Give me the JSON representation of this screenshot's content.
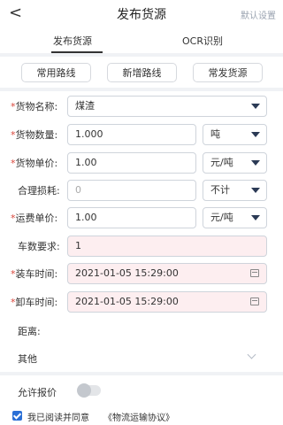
{
  "header": {
    "back_icon": "chevron-left-icon",
    "back_glyph": "<",
    "title": "发布货源",
    "right_link": "默认设置"
  },
  "tabs": [
    {
      "label": "发布货源",
      "active": true
    },
    {
      "label": "OCR识别",
      "active": false
    }
  ],
  "quick_actions": [
    "常用路线",
    "新增路线",
    "常发货源"
  ],
  "form": {
    "goods_name": {
      "label": "货物名称:",
      "required": true,
      "value": "煤渣"
    },
    "goods_qty": {
      "label": "货物数量:",
      "required": true,
      "value": "1.000",
      "unit": "吨"
    },
    "goods_price": {
      "label": "货物单价:",
      "required": true,
      "value": "1.00",
      "unit": "元/吨"
    },
    "loss": {
      "label": "合理损耗:",
      "required": false,
      "placeholder": "0",
      "unit": "不计"
    },
    "freight_price": {
      "label": "运费单价:",
      "required": true,
      "value": "1.00",
      "unit": "元/吨"
    },
    "car_count": {
      "label": "车数要求:",
      "required": false,
      "value": "1"
    },
    "load_time": {
      "label": "装车时间:",
      "required": true,
      "value": "2021-01-05 15:29:00"
    },
    "unload_time": {
      "label": "卸车时间:",
      "required": true,
      "value": "2021-01-05 15:29:00"
    },
    "distance": {
      "label": "距离:"
    }
  },
  "other": {
    "label": "其他"
  },
  "allow_quote": {
    "label": "允许报价",
    "enabled": false
  },
  "agreement": {
    "checked": true,
    "text": "我已阅读并同意",
    "link": "《物流运输协议》"
  },
  "colors": {
    "required": "#d9463b",
    "accent": "#2a6fd6",
    "pink_field": "#fdeef0"
  }
}
